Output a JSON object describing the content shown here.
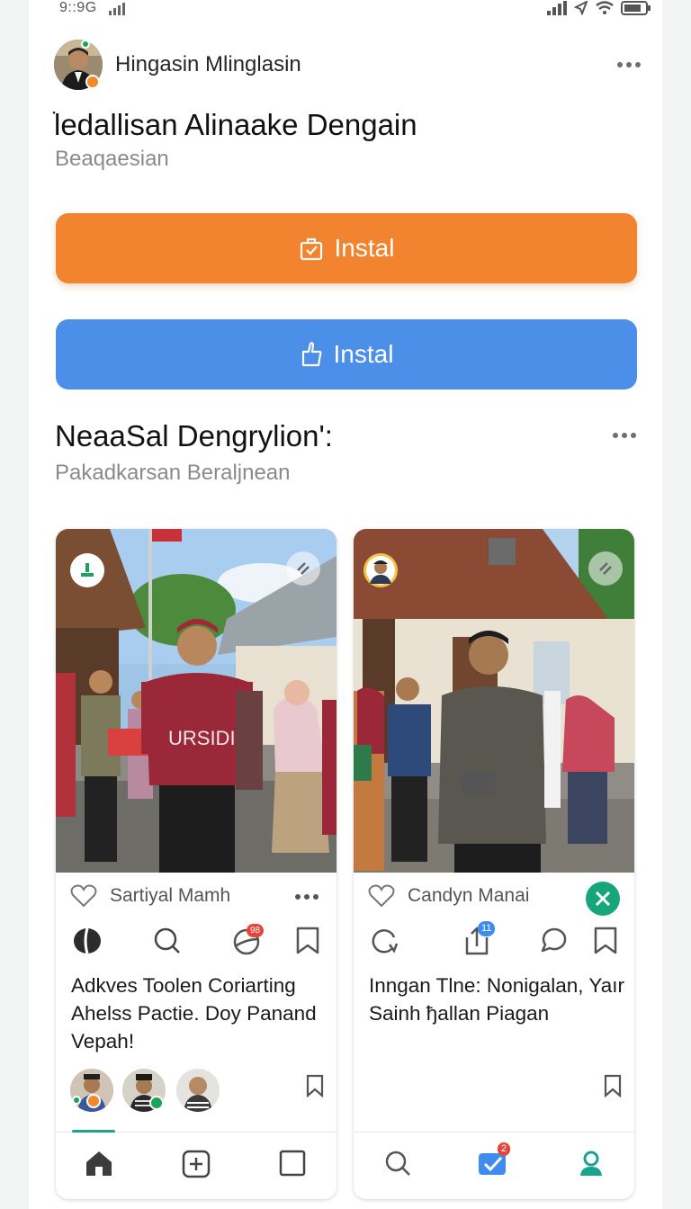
{
  "status": {
    "time": "9::9G"
  },
  "post": {
    "author": "Hingasin Mlinglasin",
    "title": "ׂledallisan Alinaake Dengain",
    "subtitle": "Beaqaesian"
  },
  "buttons": {
    "primary_label": "Instal",
    "secondary_label": "Instal"
  },
  "section": {
    "title": "NeaaSal Dengrylion':",
    "subtitle": "Pakadkarsan Beraljnean"
  },
  "cards": [
    {
      "username": "Sartiyal Mamh",
      "text": "Adkves Toolen Coriarting Ahelss Pactie. Doy Panand Vepah!",
      "badge": "98"
    },
    {
      "username": "Candyn Manai",
      "text": "Inngan Tlne: Nonigalan, Yaır Sainh ђallan Piagan",
      "badge": "11",
      "nav_badge": "2"
    }
  ],
  "colors": {
    "orange": "#f2832f",
    "blue": "#4b8fe8",
    "teal": "#1aa38f",
    "green_close": "#17a57a"
  },
  "icons": [
    "heart-icon",
    "more-icon",
    "search-icon",
    "chat-icon",
    "bookmark-icon",
    "repost-icon",
    "share-icon",
    "home-icon",
    "add-icon",
    "square-icon",
    "check-icon",
    "profile-icon",
    "close-icon",
    "bag-icon",
    "thumbs-up-icon"
  ]
}
